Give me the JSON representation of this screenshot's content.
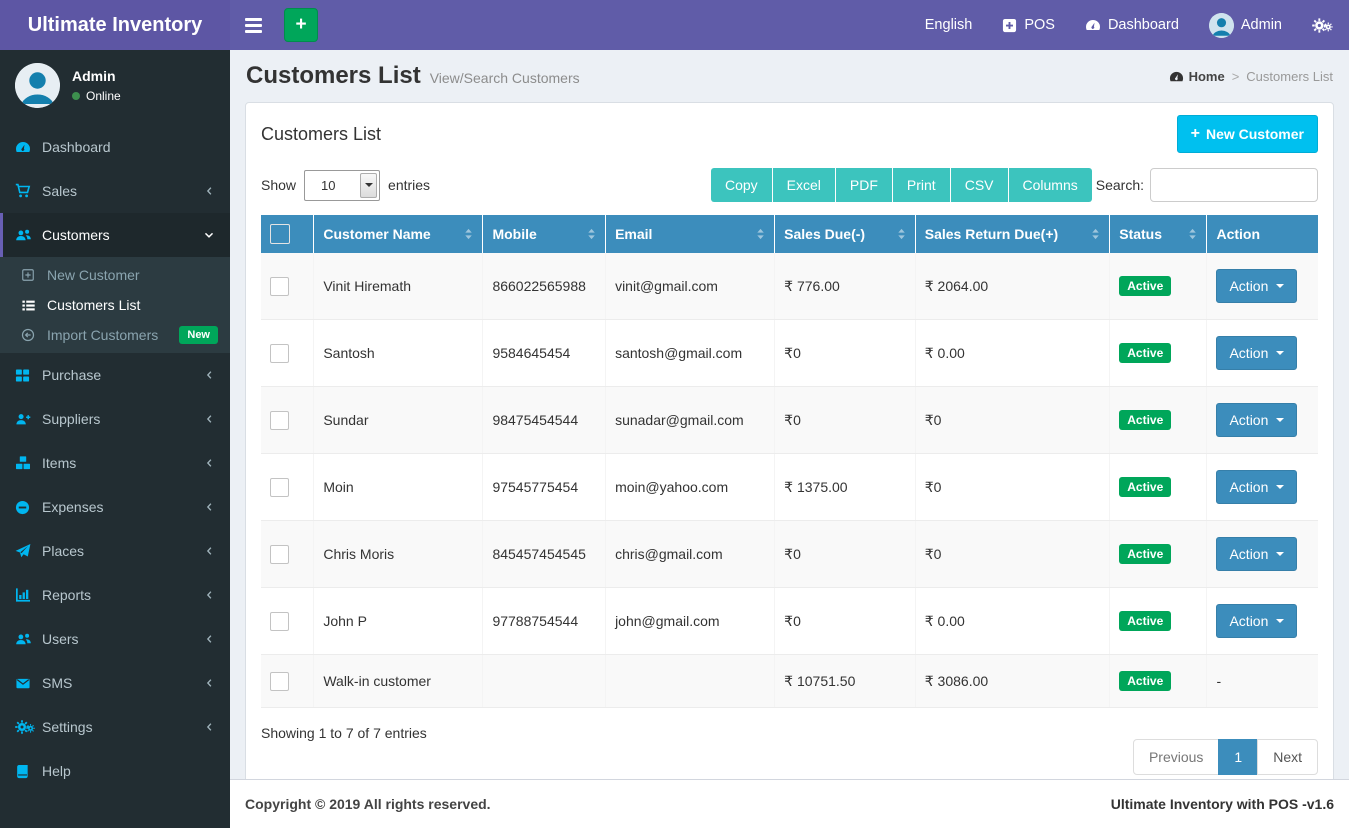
{
  "icons": {
    "plus": "+",
    "dash": "-"
  },
  "topbar": {
    "brand": "Ultimate Inventory",
    "language": "English",
    "pos": "POS",
    "dashboard": "Dashboard",
    "username": "Admin"
  },
  "sidebar": {
    "user_name": "Admin",
    "user_status": "Online",
    "items": [
      {
        "label": "Dashboard"
      },
      {
        "label": "Sales"
      },
      {
        "label": "Customers"
      },
      {
        "label": "Purchase"
      },
      {
        "label": "Suppliers"
      },
      {
        "label": "Items"
      },
      {
        "label": "Expenses"
      },
      {
        "label": "Places"
      },
      {
        "label": "Reports"
      },
      {
        "label": "Users"
      },
      {
        "label": "SMS"
      },
      {
        "label": "Settings"
      },
      {
        "label": "Help"
      }
    ],
    "submenu": [
      {
        "label": "New Customer"
      },
      {
        "label": "Customers List"
      },
      {
        "label": "Import Customers",
        "badge": "New"
      }
    ]
  },
  "page": {
    "title": "Customers List",
    "subtitle": "View/Search Customers",
    "breadcrumb_home": "Home",
    "breadcrumb_current": "Customers List"
  },
  "panel": {
    "title": "Customers List",
    "new_customer_label": "New Customer"
  },
  "toolbar": {
    "show_label": "Show",
    "entries_value": "10",
    "entries_label": "entries",
    "buttons": [
      "Copy",
      "Excel",
      "PDF",
      "Print",
      "CSV",
      "Columns"
    ],
    "search_label": "Search:"
  },
  "table": {
    "headers": [
      "Customer Name",
      "Mobile",
      "Email",
      "Sales Due(-)",
      "Sales Return Due(+)",
      "Status",
      "Action"
    ],
    "rows": [
      {
        "name": "Vinit Hiremath",
        "mobile": "866022565988",
        "email": "vinit@gmail.com",
        "sales_due": "₹ 776.00",
        "sales_return_due": "₹ 2064.00",
        "status": "Active",
        "action": "Action"
      },
      {
        "name": "Santosh",
        "mobile": "9584645454",
        "email": "santosh@gmail.com",
        "sales_due": "₹0",
        "sales_return_due": "₹ 0.00",
        "status": "Active",
        "action": "Action"
      },
      {
        "name": "Sundar",
        "mobile": "98475454544",
        "email": "sunadar@gmail.com",
        "sales_due": "₹0",
        "sales_return_due": "₹0",
        "status": "Active",
        "action": "Action"
      },
      {
        "name": "Moin",
        "mobile": "97545775454",
        "email": "moin@yahoo.com",
        "sales_due": "₹ 1375.00",
        "sales_return_due": "₹0",
        "status": "Active",
        "action": "Action"
      },
      {
        "name": "Chris Moris",
        "mobile": "845457454545",
        "email": "chris@gmail.com",
        "sales_due": "₹0",
        "sales_return_due": "₹0",
        "status": "Active",
        "action": "Action"
      },
      {
        "name": "John P",
        "mobile": "97788754544",
        "email": "john@gmail.com",
        "sales_due": "₹0",
        "sales_return_due": "₹ 0.00",
        "status": "Active",
        "action": "Action"
      },
      {
        "name": "Walk-in customer",
        "mobile": "",
        "email": "",
        "sales_due": "₹ 10751.50",
        "sales_return_due": "₹ 3086.00",
        "status": "Active",
        "action": "-"
      }
    ],
    "summary": "Showing 1 to 7 of 7 entries"
  },
  "pagination": {
    "previous": "Previous",
    "page": "1",
    "next": "Next"
  },
  "footer": {
    "left": "Copyright © 2019 All rights reserved.",
    "right": "Ultimate Inventory with POS -v1.6"
  },
  "colors": {
    "topbar_purple": "#605ca8",
    "logo_purple": "#5d56a4",
    "sidebar_dark": "#222d32",
    "submenu_dark": "#2c3b41",
    "icon_cyan": "#00b6f0",
    "table_header_blue": "#3c8dbc",
    "button_teal": "#3cc4be",
    "new_customer_cyan": "#00c0ef",
    "success_green": "#00a65a",
    "content_bg": "#ecf0f5"
  }
}
